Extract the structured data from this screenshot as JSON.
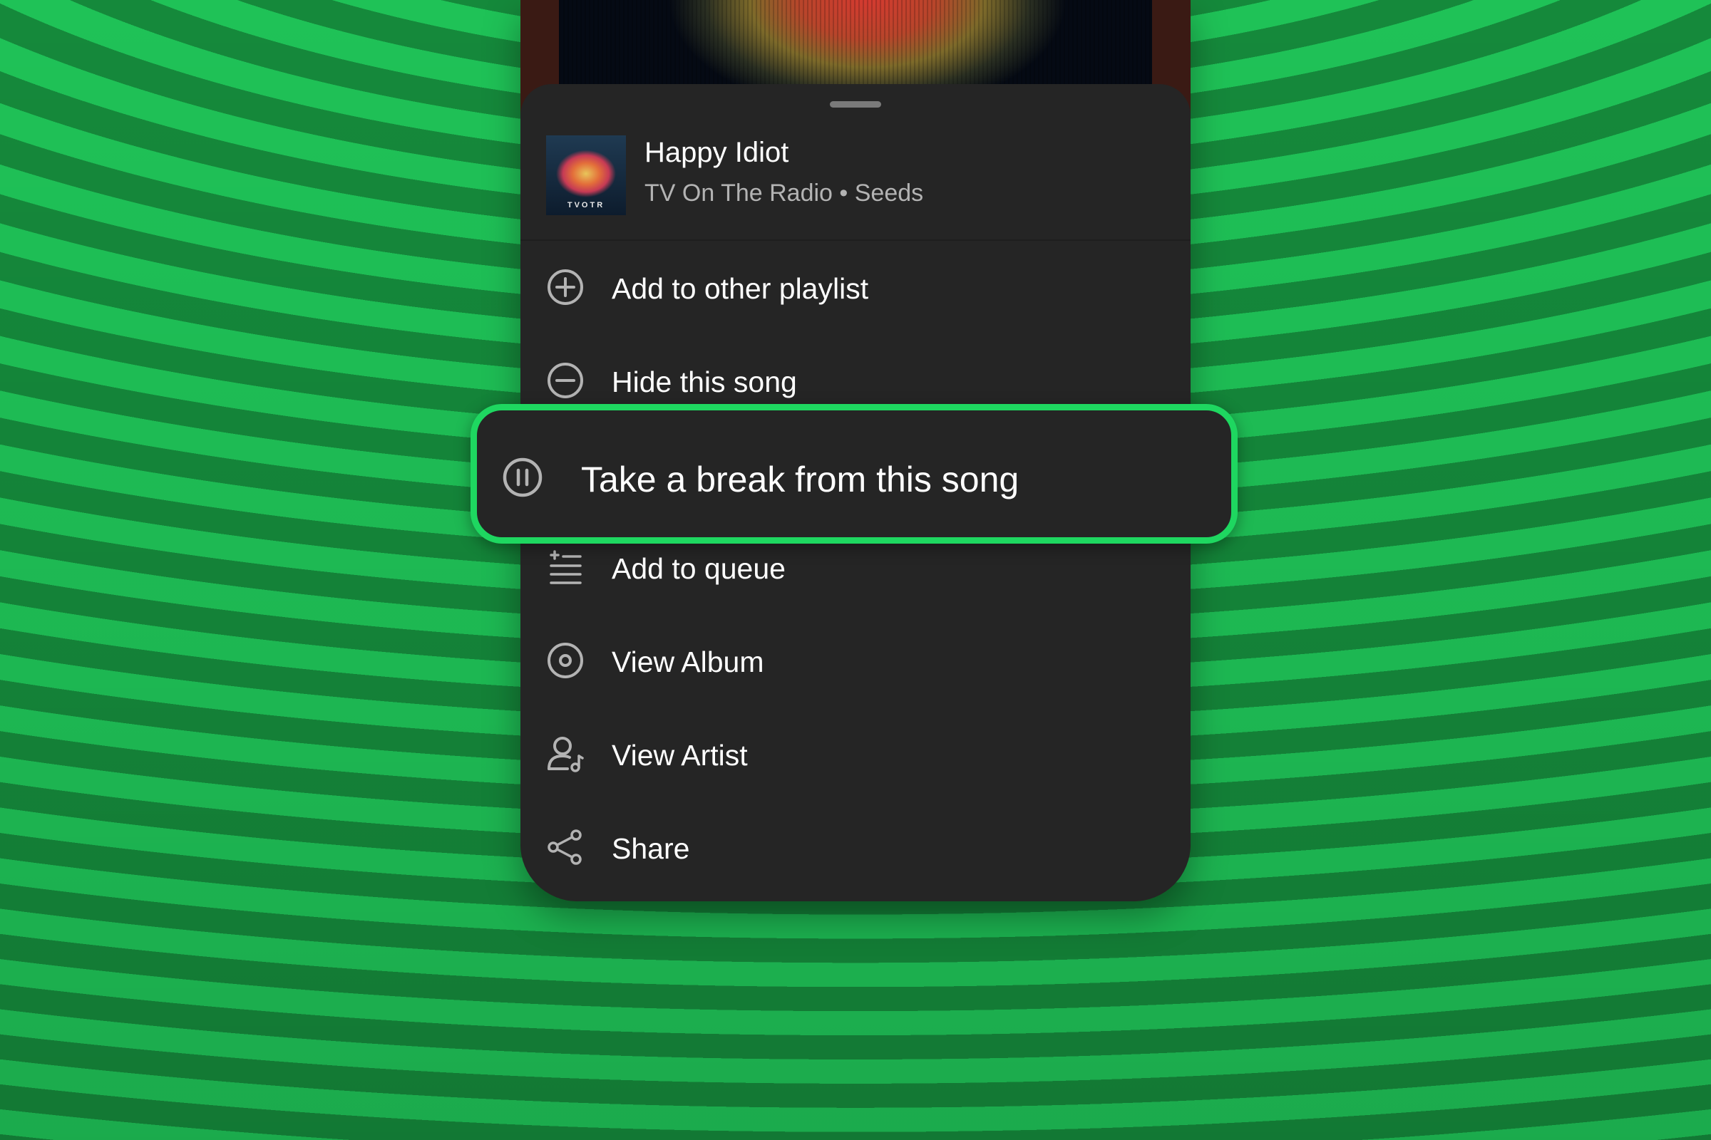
{
  "colors": {
    "background_light": "#1fc257",
    "background_dark": "#15893b",
    "sheet": "#252525",
    "highlight_border": "#1ed760",
    "primary_text": "#ffffff",
    "secondary_text": "#b3b3b3",
    "icon": "#b3b3b3"
  },
  "track": {
    "title": "Happy Idiot",
    "subtitle": "TV On The Radio • Seeds",
    "album_art_text": "TVOTR"
  },
  "menu": {
    "items": [
      {
        "label": "Add to other playlist",
        "icon": "add-circle-icon"
      },
      {
        "label": "Hide this song",
        "icon": "minus-circle-icon"
      },
      {
        "label": "Take a break from this song",
        "icon": "pause-circle-icon",
        "highlighted": true
      },
      {
        "label": "Add to queue",
        "icon": "add-to-queue-icon"
      },
      {
        "label": "View Album",
        "icon": "album-icon"
      },
      {
        "label": "View Artist",
        "icon": "artist-icon"
      },
      {
        "label": "Share",
        "icon": "share-icon"
      }
    ]
  }
}
